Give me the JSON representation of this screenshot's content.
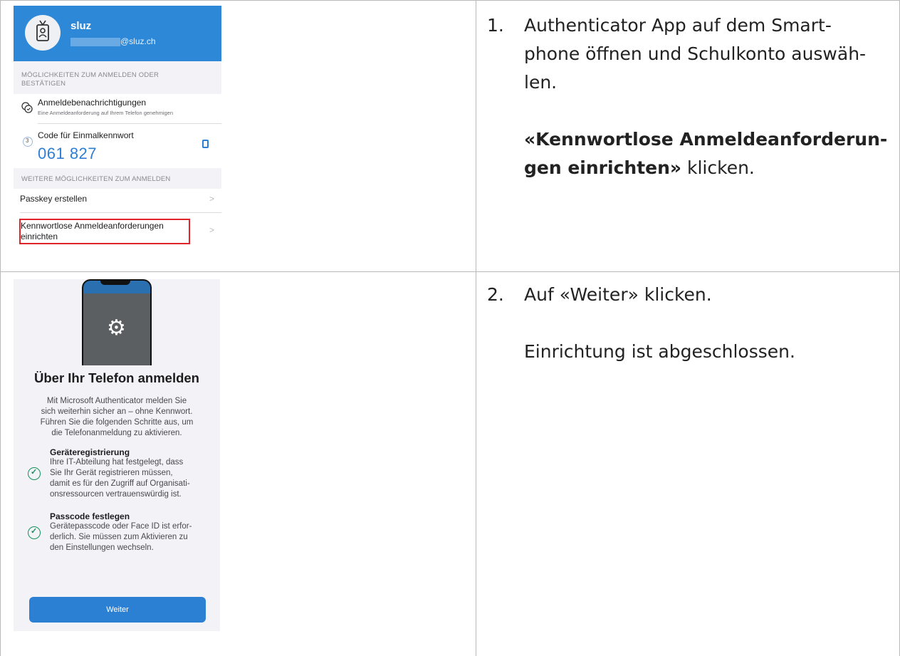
{
  "steps": [
    {
      "number": "1.",
      "line1": "Authenticator App auf dem Smart-",
      "line2": "phone öffnen und Schulkonto auswäh-",
      "line3": "len.",
      "instruction_bold_1": "«Kennwortlose Anmeldeanforderun-",
      "instruction_bold_2": "gen einrichten»",
      "instruction_rest": " klicken."
    },
    {
      "number": "2.",
      "text": "Auf «Weiter» klicken.",
      "note": "Einrichtung ist abgeschlossen."
    }
  ],
  "screen1": {
    "account_name": "sluz",
    "account_email_suffix": "@sluz.ch",
    "section_sign_in_1": "MÖGLICHKEITEN ZUM ANMELDEN ODER",
    "section_sign_in_2": "BESTÄTIGEN",
    "notifications_title": "Anmeldebenachrichtigungen",
    "notifications_subtitle": "Eine Anmeldeanforderung auf Ihrem Telefon genehmigen",
    "otp_title": "Code für Einmalkennwort",
    "otp_timer": "3",
    "otp_code": "061 827",
    "section_more": "WEITERE MÖGLICHKEITEN ZUM ANMELDEN",
    "passkey_label": "Passkey erstellen",
    "passwordless_label_1": "Kennwortlose Anmeldeanforderungen",
    "passwordless_label_2": "einrichten",
    "chevron": ">",
    "highlight_color": "#e0242a",
    "header_color": "#2d88d8"
  },
  "screen2": {
    "title": "Über Ihr Telefon anmelden",
    "intro": [
      "Mit Microsoft Authenticator melden Sie",
      "sich weiterhin sicher an – ohne Kennwort.",
      "Führen Sie die folgenden Schritte aus, um",
      "die Telefonanmeldung zu aktivieren."
    ],
    "item1_title": "Geräteregistrierung",
    "item1_text": [
      "Ihre IT-Abteilung hat festgelegt, dass",
      "Sie Ihr Gerät registrieren müssen,",
      "damit es für den Zugriff auf Organisati-",
      "onsressourcen vertrauenswürdig ist."
    ],
    "item2_title": "Passcode festlegen",
    "item2_text": [
      "Gerätepasscode oder Face ID ist erfor-",
      "derlich. Sie müssen zum Aktivieren zu",
      "den Einstellungen wechseln."
    ],
    "button_label": "Weiter",
    "button_color": "#2b80d3",
    "check_color": "#14925b"
  }
}
